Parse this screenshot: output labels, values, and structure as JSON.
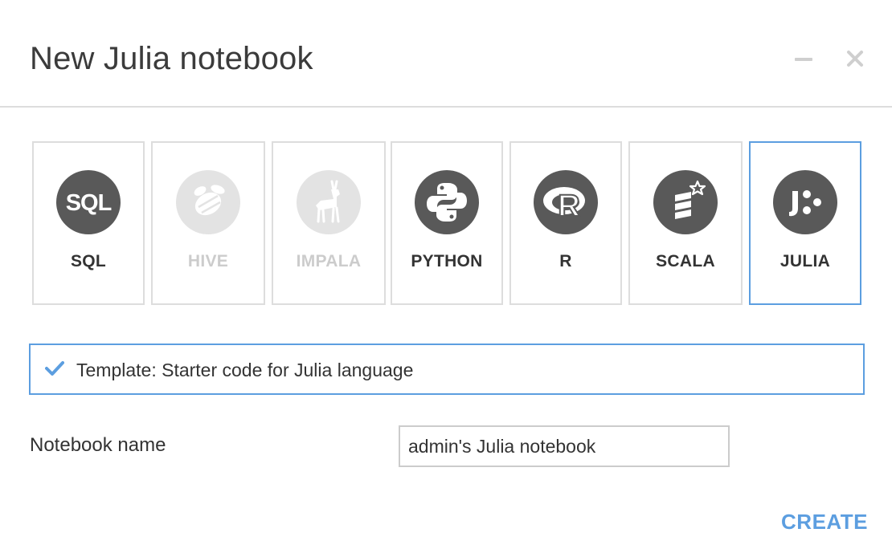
{
  "dialog": {
    "title": "New Julia notebook",
    "minimize_icon": "minimize-icon",
    "close_icon": "close-icon"
  },
  "languages": [
    {
      "label": "SQL",
      "icon": "sql-icon",
      "enabled": true,
      "selected": false
    },
    {
      "label": "HIVE",
      "icon": "hive-icon",
      "enabled": false,
      "selected": false
    },
    {
      "label": "IMPALA",
      "icon": "impala-icon",
      "enabled": false,
      "selected": false
    },
    {
      "label": "PYTHON",
      "icon": "python-icon",
      "enabled": true,
      "selected": false
    },
    {
      "label": "R",
      "icon": "r-icon",
      "enabled": true,
      "selected": false
    },
    {
      "label": "SCALA",
      "icon": "scala-icon",
      "enabled": true,
      "selected": false
    },
    {
      "label": "JULIA",
      "icon": "julia-icon",
      "enabled": true,
      "selected": true
    }
  ],
  "template": {
    "text": "Template: Starter code for Julia language",
    "icon": "checkmark-icon",
    "checked": true
  },
  "notebook_name": {
    "label": "Notebook name",
    "value": "admin's Julia notebook"
  },
  "actions": {
    "create_label": "CREATE"
  },
  "colors": {
    "accent": "#5c9ee0",
    "border": "#dddddd",
    "logo_active": "#595959",
    "logo_disabled": "#e3e3e3",
    "text_disabled": "#cccccc"
  }
}
